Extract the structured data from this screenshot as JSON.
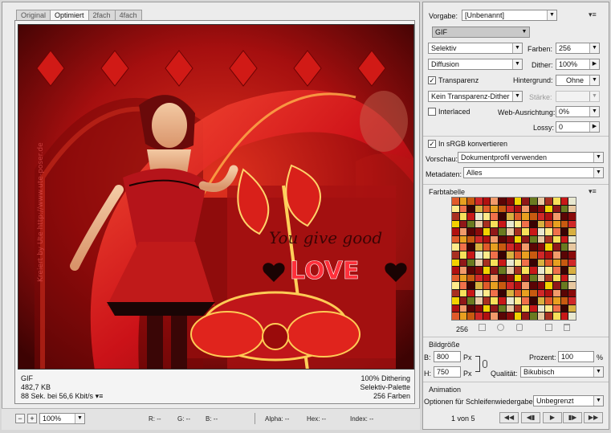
{
  "tabs": [
    {
      "label": "Original",
      "active": false
    },
    {
      "label": "Optimiert",
      "active": true
    },
    {
      "label": "2fach",
      "active": false
    },
    {
      "label": "4fach",
      "active": false
    }
  ],
  "image": {
    "artwork_text_1": "You give good",
    "artwork_text_2": "LOVE",
    "watermark": "Kreiert by Ute http://www.ute-poser.de"
  },
  "info_left": {
    "format": "GIF",
    "size": "482,7 KB",
    "time": "88 Sek. bei 56,6 Kbit/s"
  },
  "info_right": {
    "dither": "100% Dithering",
    "palette": "Selektiv-Palette",
    "colors": "256 Farben"
  },
  "statusbar": {
    "zoom": "100%",
    "r": "R: --",
    "g": "G: --",
    "b": "B: --",
    "alpha": "Alpha: --",
    "hex": "Hex: --",
    "index": "Index: --"
  },
  "panel": {
    "preset_label": "Vorgabe:",
    "preset_value": "[Unbenannt]",
    "format_value": "GIF",
    "reduction_value": "Selektiv",
    "colors_label": "Farben:",
    "colors_value": "256",
    "dither_algo": "Diffusion",
    "dither_label": "Dither:",
    "dither_value": "100%",
    "transparency_label": "Transparenz",
    "transparency_checked": true,
    "matte_label": "Hintergrund:",
    "matte_value": "Ohne",
    "trans_dither_value": "Kein Transparenz-Dither",
    "amount_label": "Stärke:",
    "amount_value": "",
    "interlaced_label": "Interlaced",
    "interlaced_checked": false,
    "websnap_label": "Web-Ausrichtung:",
    "websnap_value": "0%",
    "lossy_label": "Lossy:",
    "lossy_value": "0",
    "srgb_label": "In sRGB konvertieren",
    "srgb_checked": true,
    "preview_label": "Vorschau:",
    "preview_value": "Dokumentprofil verwenden",
    "metadata_label": "Metadaten:",
    "metadata_value": "Alles",
    "colortable_title": "Farbtabelle",
    "colortable_count": "256",
    "imagesize_title": "Bildgröße",
    "width_label": "B:",
    "width_value": "800",
    "height_label": "H:",
    "height_value": "750",
    "px_unit": "Px",
    "percent_label": "Prozent:",
    "percent_value": "100",
    "percent_unit": "%",
    "quality_label": "Qualität:",
    "quality_value": "Bikubisch",
    "animation_title": "Animation",
    "loop_label": "Optionen für Schleifenwiedergabe:",
    "loop_value": "Unbegrenzt",
    "frame_counter": "1 von 5"
  },
  "colors": {
    "accent_red": "#c1121a",
    "panel_bg": "#ececec"
  }
}
